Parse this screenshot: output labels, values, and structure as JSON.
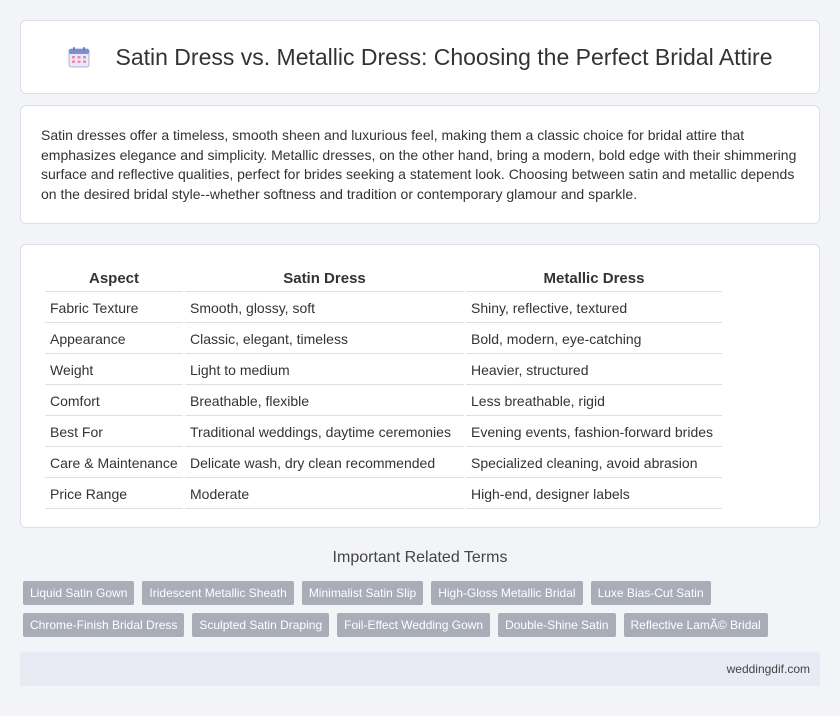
{
  "header": {
    "title": "Satin Dress vs. Metallic Dress: Choosing the Perfect Bridal Attire",
    "icon": "calendar-icon"
  },
  "intro": {
    "text": "Satin dresses offer a timeless, smooth sheen and luxurious feel, making them a classic choice for bridal attire that emphasizes elegance and simplicity. Metallic dresses, on the other hand, bring a modern, bold edge with their shimmering surface and reflective qualities, perfect for brides seeking a statement look. Choosing between satin and metallic depends on the desired bridal style--whether softness and tradition or contemporary glamour and sparkle."
  },
  "table": {
    "headers": [
      "Aspect",
      "Satin Dress",
      "Metallic Dress"
    ],
    "rows": [
      [
        "Fabric Texture",
        "Smooth, glossy, soft",
        "Shiny, reflective, textured"
      ],
      [
        "Appearance",
        "Classic, elegant, timeless",
        "Bold, modern, eye-catching"
      ],
      [
        "Weight",
        "Light to medium",
        "Heavier, structured"
      ],
      [
        "Comfort",
        "Breathable, flexible",
        "Less breathable, rigid"
      ],
      [
        "Best For",
        "Traditional weddings, daytime ceremonies",
        "Evening events, fashion-forward brides"
      ],
      [
        "Care & Maintenance",
        "Delicate wash, dry clean recommended",
        "Specialized cleaning, avoid abrasion"
      ],
      [
        "Price Range",
        "Moderate",
        "High-end, designer labels"
      ]
    ]
  },
  "related": {
    "title": "Important Related Terms",
    "tags_row1": [
      "Liquid Satin Gown",
      "Iridescent Metallic Sheath",
      "Minimalist Satin Slip",
      "High-Gloss Metallic Bridal",
      "Luxe Bias-Cut Satin"
    ],
    "tags_row2": [
      "Chrome-Finish Bridal Dress",
      "Sculpted Satin Draping",
      "Foil-Effect Wedding Gown",
      "Double-Shine Satin",
      "Reflective LamÃ© Bridal"
    ]
  },
  "footer": {
    "site": "weddingdif.com"
  },
  "colors": {
    "tag_bg": "#a8adb8",
    "footer_bg": "#e8ebf3",
    "page_bg": "#f3f4f8"
  }
}
